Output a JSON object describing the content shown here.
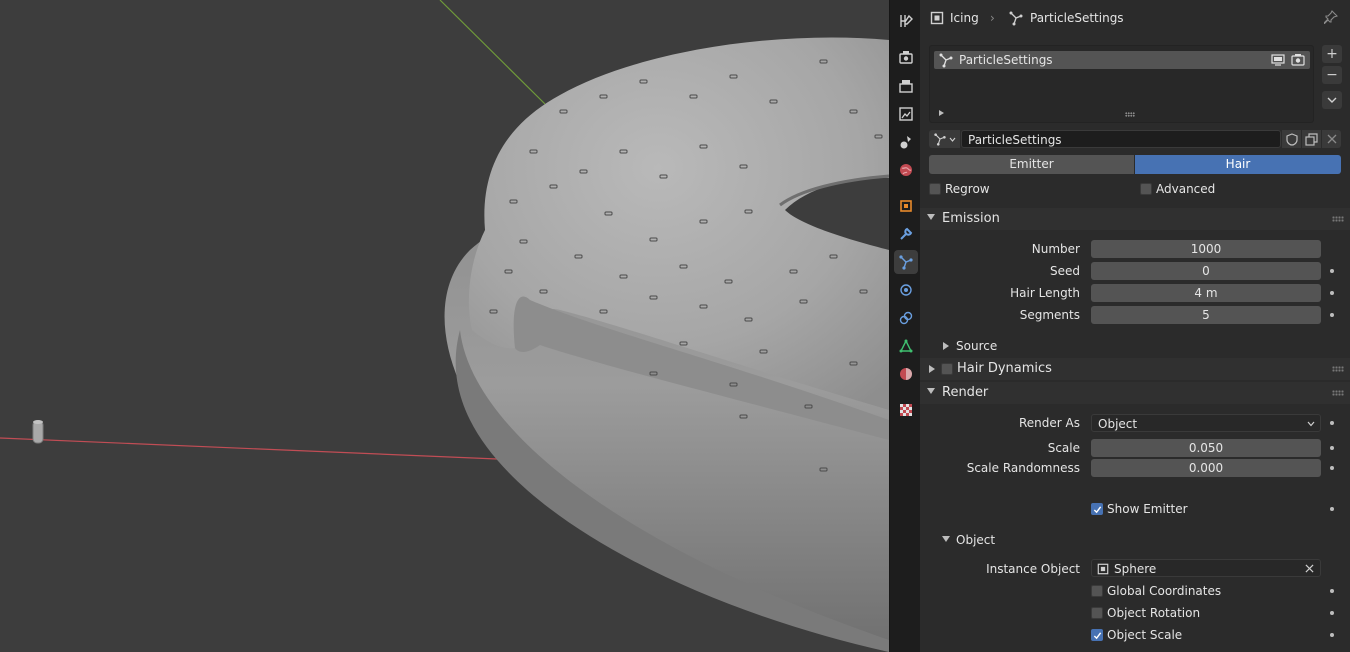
{
  "breadcrumb": {
    "object": "Icing",
    "data": "ParticleSettings"
  },
  "particle_list": {
    "items": [
      {
        "label": "ParticleSettings"
      }
    ]
  },
  "datablock": {
    "name": "ParticleSettings"
  },
  "type_toggle": {
    "emitter_label": "Emitter",
    "hair_label": "Hair",
    "selected": "Hair"
  },
  "options": {
    "regrow_label": "Regrow",
    "regrow_checked": false,
    "advanced_label": "Advanced",
    "advanced_checked": false
  },
  "emission": {
    "title": "Emission",
    "number_label": "Number",
    "number_value": "1000",
    "seed_label": "Seed",
    "seed_value": "0",
    "hair_length_label": "Hair Length",
    "hair_length_value": "4 m",
    "segments_label": "Segments",
    "segments_value": "5",
    "source_label": "Source"
  },
  "hair_dynamics": {
    "title": "Hair Dynamics",
    "enabled": false
  },
  "render": {
    "title": "Render",
    "render_as_label": "Render As",
    "render_as_value": "Object",
    "scale_label": "Scale",
    "scale_value": "0.050",
    "scale_randomness_label": "Scale Randomness",
    "scale_randomness_value": "0.000",
    "show_emitter_label": "Show Emitter",
    "show_emitter_checked": true
  },
  "object_panel": {
    "title": "Object",
    "instance_object_label": "Instance Object",
    "instance_object_value": "Sphere",
    "global_coordinates_label": "Global Coordinates",
    "global_coordinates_checked": false,
    "object_rotation_label": "Object Rotation",
    "object_rotation_checked": false,
    "object_scale_label": "Object Scale",
    "object_scale_checked": true
  },
  "colors": {
    "accent": "#4772b3",
    "panel_bg": "#2b2b2b",
    "viewport_bg": "#3d3d3d",
    "field_bg": "#545454",
    "x_axis": "#c14d55",
    "y_axis": "#6f9a3a"
  }
}
